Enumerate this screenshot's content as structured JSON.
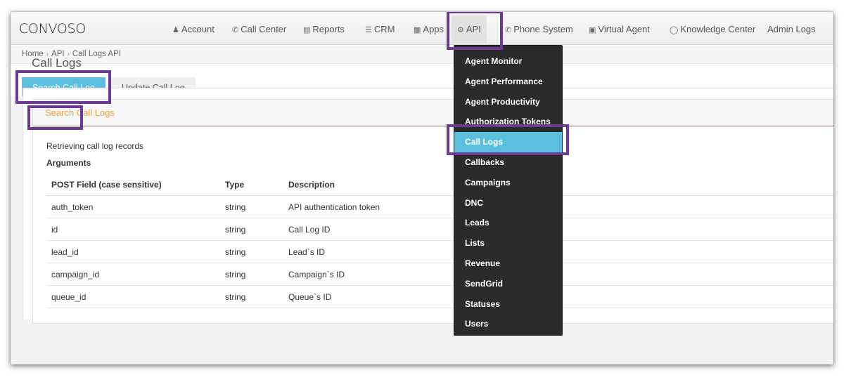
{
  "brand": {
    "logo": "CONVOSO"
  },
  "nav": {
    "items": [
      {
        "label": "Account",
        "icon": "user-icon"
      },
      {
        "label": "Call Center",
        "icon": "phone-icon"
      },
      {
        "label": "Reports",
        "icon": "bar-chart-icon"
      },
      {
        "label": "CRM",
        "icon": "list-icon"
      },
      {
        "label": "Apps",
        "icon": "grid-icon"
      },
      {
        "label": "API",
        "icon": "gear-icon"
      },
      {
        "label": "Phone System",
        "icon": "phone-icon"
      },
      {
        "label": "Virtual Agent",
        "icon": "monitor-icon"
      },
      {
        "label": "Knowledge Center",
        "icon": "lightbulb-icon"
      },
      {
        "label": "Admin Logs",
        "icon": ""
      }
    ]
  },
  "breadcrumb": {
    "items": [
      "Home",
      "API",
      "Call Logs API"
    ]
  },
  "tabs": {
    "search": "Search Call Log",
    "update": "Update Call Log"
  },
  "page": {
    "title": "Call Logs"
  },
  "panel": {
    "heading": "Search Call Logs",
    "intro": "Retrieving call log records",
    "args_label": "Arguments"
  },
  "table": {
    "headers": [
      "POST Field (case sensitive)",
      "Type",
      "Description"
    ],
    "rows": [
      [
        "auth_token",
        "string",
        "API authentication token"
      ],
      [
        "id",
        "string",
        "Call Log ID"
      ],
      [
        "lead_id",
        "string",
        "Lead`s ID"
      ],
      [
        "campaign_id",
        "string",
        "Campaign`s ID"
      ],
      [
        "queue_id",
        "string",
        "Queue`s ID"
      ]
    ]
  },
  "api_menu": {
    "items": [
      "Agent Monitor",
      "Agent Performance",
      "Agent Productivity",
      "Authorization Tokens",
      "Call Logs",
      "Callbacks",
      "Campaigns",
      "DNC",
      "Leads",
      "Lists",
      "Revenue",
      "SendGrid",
      "Statuses",
      "Users"
    ],
    "active": "Call Logs"
  },
  "colors": {
    "accent": "#5bc0de",
    "highlight": "#6a3a94",
    "panel_heading": "#f0a23a",
    "menu_bg": "#2b2b2b"
  }
}
